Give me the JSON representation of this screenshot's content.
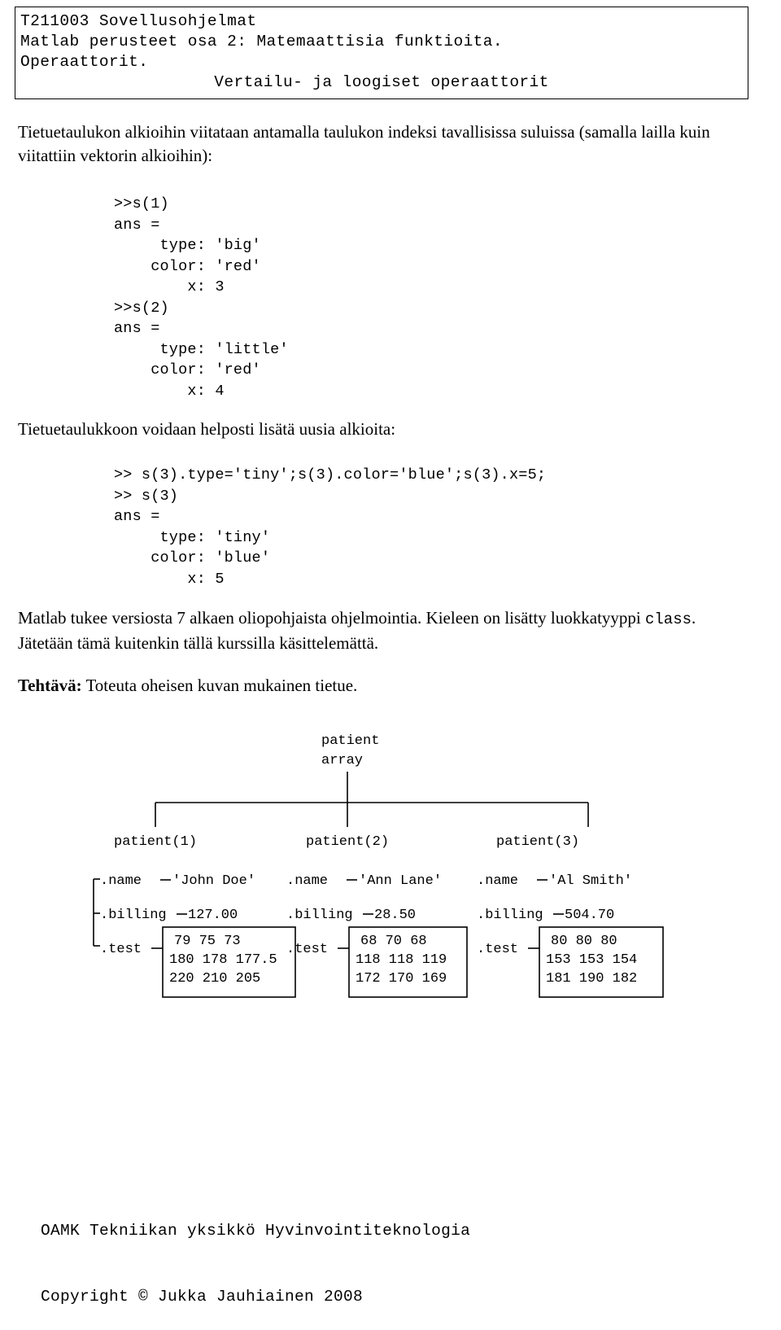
{
  "header": {
    "line1": "T211003 Sovellusohjelmat",
    "line2": "Matlab perusteet osa 2: Matemaattisia funktioita.",
    "line3": "Operaattorit.",
    "line4": "Vertailu- ja loogiset operaattorit"
  },
  "body": {
    "intro": "Tietuetaulukon alkioihin viitataan antamalla taulukon indeksi tavallisissa suluissa (samalla lailla kuin viitattiin vektorin alkioihin):",
    "code_block_1": ">>s(1)\nans =\n     type: 'big'\n    color: 'red'\n        x: 3\n>>s(2)\nans =\n     type: 'little'\n    color: 'red'\n        x: 4",
    "midtext": "Tietuetaulukkoon voidaan helposti lisätä uusia alkioita:",
    "code_block_2": ">> s(3).type='tiny';s(3).color='blue';s(3).x=5;\n>> s(3)\nans =\n     type: 'tiny'\n    color: 'blue'\n        x: 5",
    "outro_part1": "Matlab tukee versiosta 7 alkaen oliopohjaista ohjelmointia. Kieleen on lisätty luokkatyyppi ",
    "outro_code": "class",
    "outro_part2": ". Jätetään tämä kuitenkin tällä kurssilla käsittelemättä.",
    "task_label": "Tehtävä:",
    "task_text": " Toteuta oheisen kuvan mukainen tietue."
  },
  "figure": {
    "root_label_line1": "patient",
    "root_label_line2": "array",
    "nodes": [
      {
        "title": "patient(1)",
        "fields": [
          ".name",
          ".billing",
          ".test"
        ],
        "name_value": "'John Doe'",
        "billing_value": "127.00",
        "matrix": [
          [
            "79",
            "75",
            "73"
          ],
          [
            "180",
            "178",
            "177.5"
          ],
          [
            "220",
            "210",
            "205"
          ]
        ]
      },
      {
        "title": "patient(2)",
        "fields": [
          ".name",
          ".billing",
          ".test"
        ],
        "name_value": "'Ann Lane'",
        "billing_value": "28.50",
        "matrix": [
          [
            "68",
            "70",
            "68"
          ],
          [
            "118",
            "118",
            "119"
          ],
          [
            "172",
            "170",
            "169"
          ]
        ]
      },
      {
        "title": "patient(3)",
        "fields": [
          ".name",
          ".billing",
          ".test"
        ],
        "name_value": "'Al Smith'",
        "billing_value": "504.70",
        "matrix": [
          [
            "80",
            "80",
            "80"
          ],
          [
            "153",
            "153",
            "154"
          ],
          [
            "181",
            "190",
            "182"
          ]
        ]
      }
    ]
  },
  "footer": {
    "line1": "OAMK Tekniikan yksikkö Hyvinvointiteknologia",
    "line2": "Copyright © Jukka Jauhiainen 2008"
  }
}
